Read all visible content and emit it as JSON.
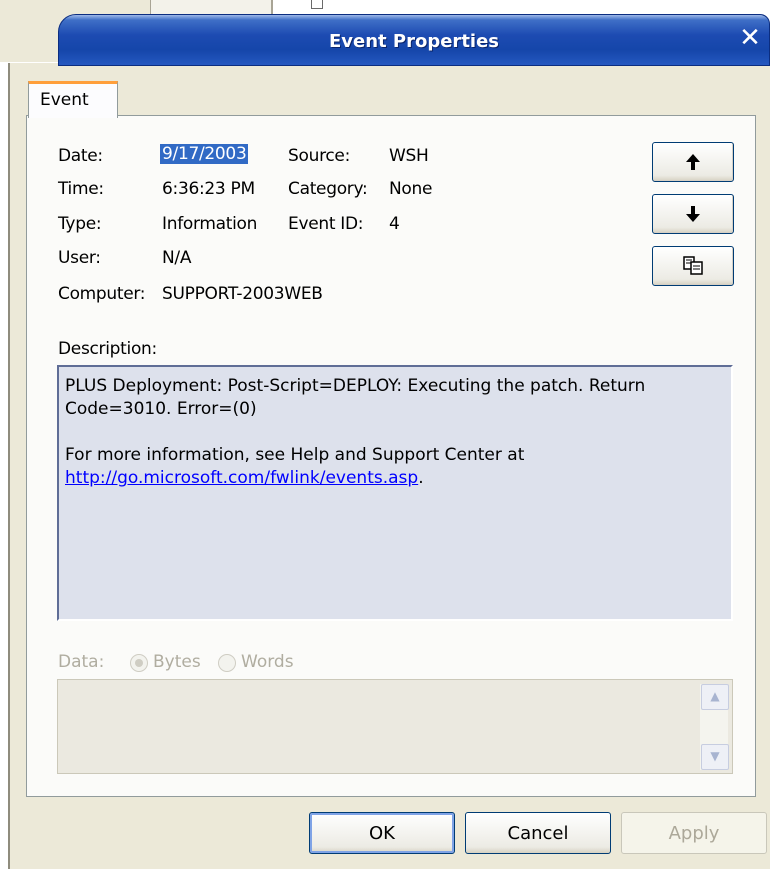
{
  "window": {
    "title": "Event Properties",
    "close_glyph": "✕"
  },
  "tabs": [
    {
      "label": "Event",
      "active": true
    }
  ],
  "fields": {
    "date": {
      "label": "Date:",
      "value": "9/17/2003"
    },
    "time": {
      "label": "Time:",
      "value": "6:36:23 PM"
    },
    "type": {
      "label": "Type:",
      "value": "Information"
    },
    "user": {
      "label": "User:",
      "value": "N/A"
    },
    "computer": {
      "label": "Computer:",
      "value": "SUPPORT-2003WEB"
    },
    "source": {
      "label": "Source:",
      "value": "WSH"
    },
    "category": {
      "label": "Category:",
      "value": "None"
    },
    "event_id": {
      "label": "Event ID:",
      "value": "4"
    }
  },
  "side_buttons": {
    "up_icon": "arrow-up-icon",
    "down_icon": "arrow-down-icon",
    "copy_icon": "copy-icon"
  },
  "description": {
    "label": "Description:",
    "line1": "PLUS Deployment: Post-Script=DEPLOY: Executing the patch. Return",
    "line2": "Code=3010. Error=(0)",
    "line3": "For more information, see Help and Support Center at",
    "link": "http://go.microsoft.com/fwlink/events.asp",
    "link_suffix": "."
  },
  "data": {
    "label": "Data:",
    "options": [
      {
        "label": "Bytes",
        "selected": true
      },
      {
        "label": "Words",
        "selected": false
      }
    ],
    "enabled": false
  },
  "buttons": {
    "ok": "OK",
    "cancel": "Cancel",
    "apply": "Apply"
  },
  "colors": {
    "titlebar": "#1d4bb2",
    "selection": "#316ac5",
    "link": "#0000ff",
    "tab_highlight": "#ff9f3b"
  }
}
